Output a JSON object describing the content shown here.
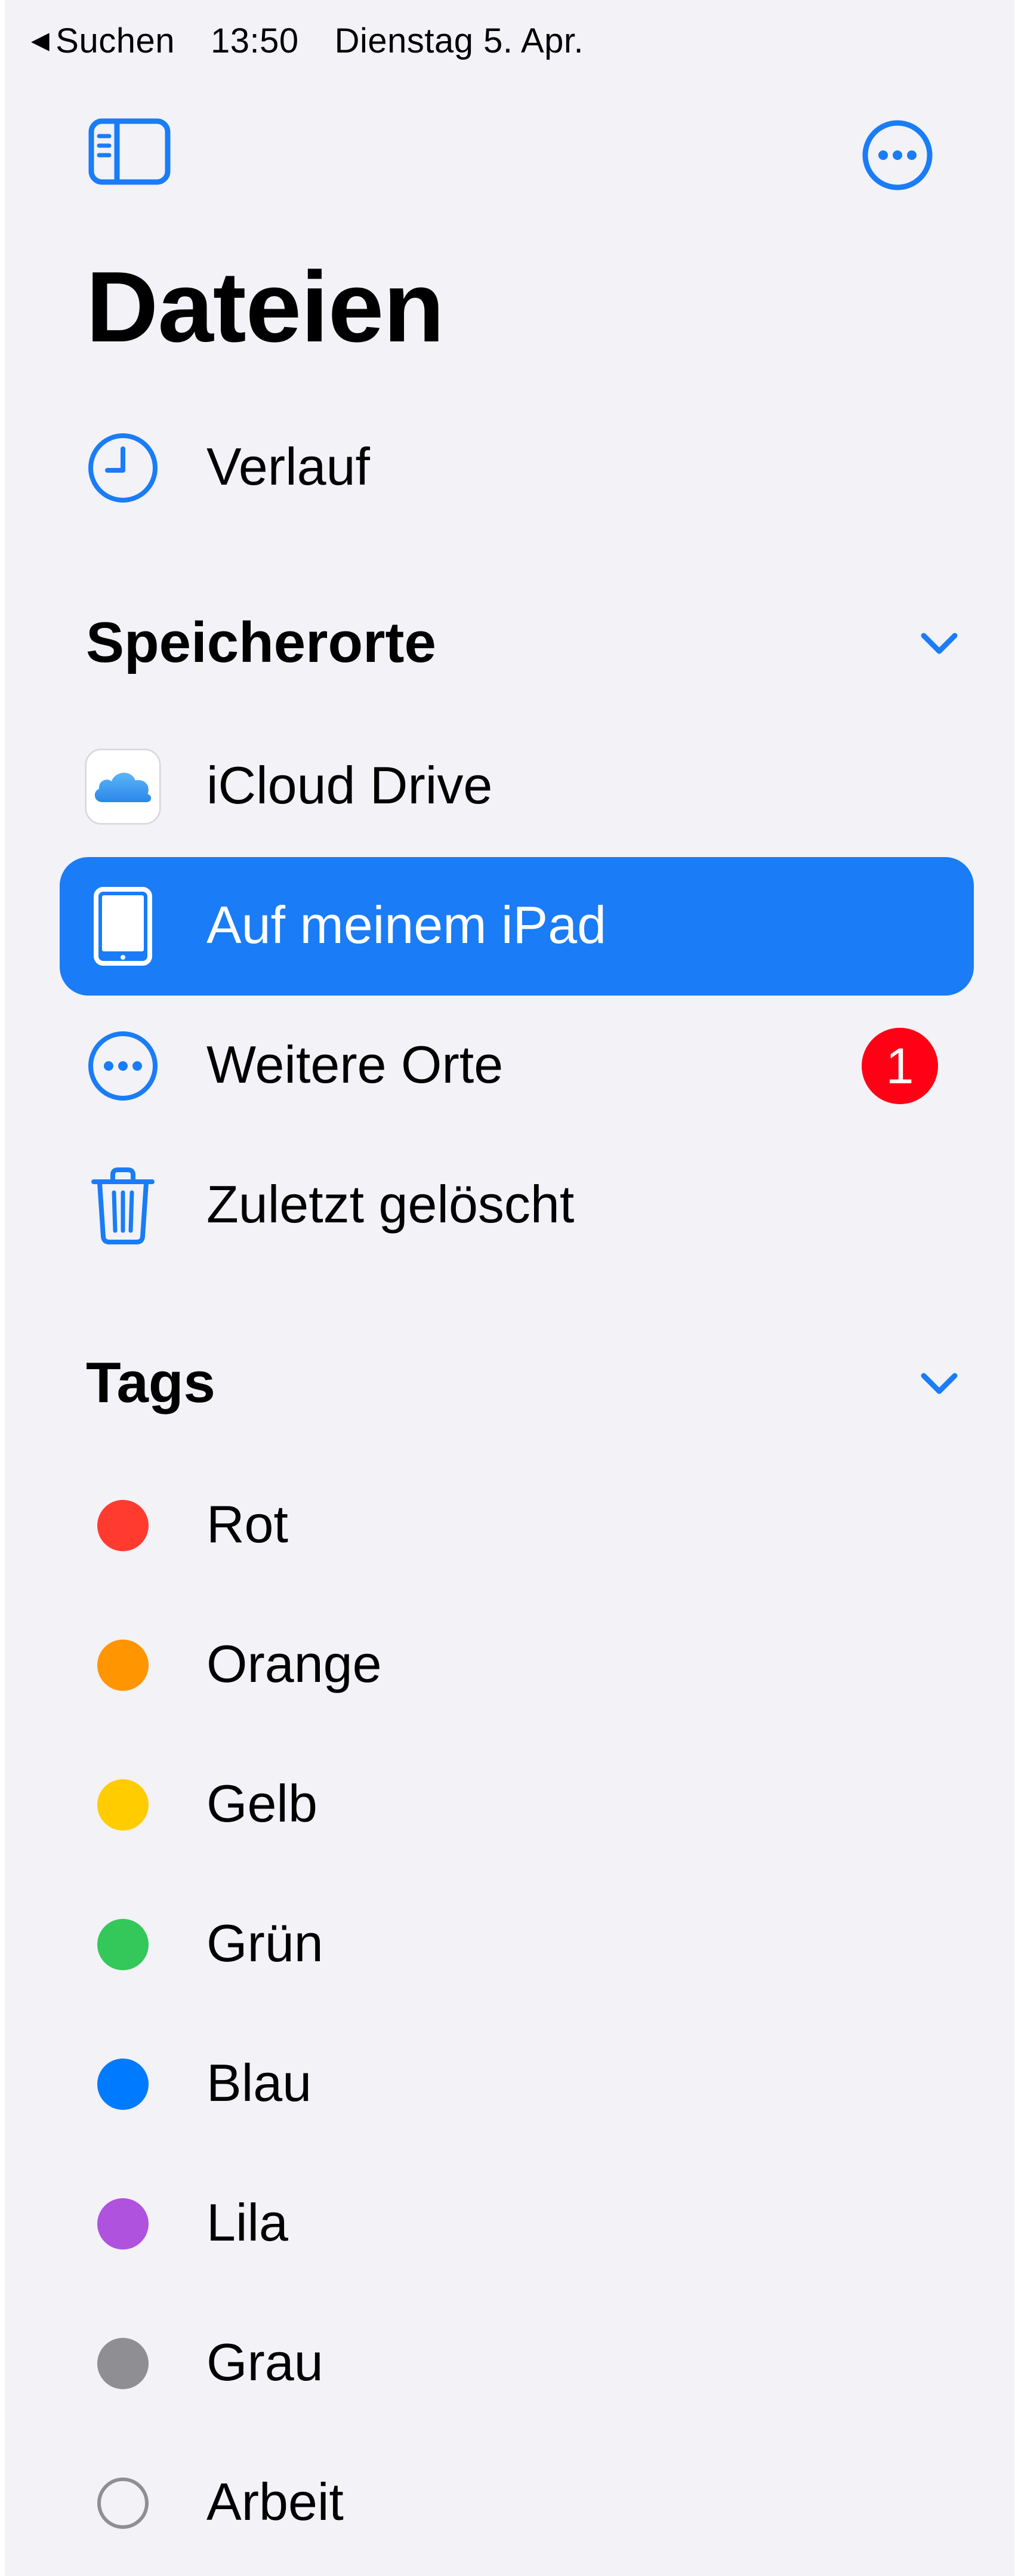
{
  "status_bar": {
    "back_label": "Suchen",
    "time": "13:50",
    "date": "Dienstag 5. Apr."
  },
  "header": {
    "title": "Dateien",
    "sidebar_toggle_icon": "sidebar-icon",
    "more_icon": "ellipsis-circle-icon"
  },
  "recents": {
    "label": "Verlauf",
    "icon": "clock-icon"
  },
  "locations": {
    "title": "Speicherorte",
    "items": [
      {
        "label": "iCloud Drive",
        "icon": "icloud-icon"
      },
      {
        "label": "Auf meinem iPad",
        "icon": "ipad-icon",
        "selected": true
      },
      {
        "label": "Weitere Orte",
        "icon": "ellipsis-circle-icon",
        "badge": "1"
      },
      {
        "label": "Zuletzt gelöscht",
        "icon": "trash-icon"
      }
    ]
  },
  "tags": {
    "title": "Tags",
    "items": [
      {
        "label": "Rot",
        "color": "#ff3b30"
      },
      {
        "label": "Orange",
        "color": "#ff9500"
      },
      {
        "label": "Gelb",
        "color": "#ffcc00"
      },
      {
        "label": "Grün",
        "color": "#34c759"
      },
      {
        "label": "Blau",
        "color": "#007aff"
      },
      {
        "label": "Lila",
        "color": "#af52de"
      },
      {
        "label": "Grau",
        "color": "#8e8e93"
      },
      {
        "label": "Arbeit",
        "color": "none"
      }
    ]
  },
  "colors": {
    "accent": "#1a7cf6",
    "background": "#f2f2f7",
    "badge": "#ff0015"
  }
}
